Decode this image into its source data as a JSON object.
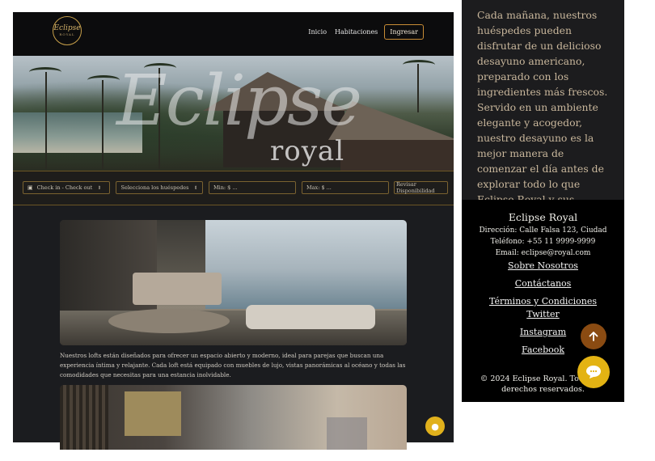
{
  "header": {
    "logo_text": "Eclipse",
    "logo_sub": "ROYAL",
    "nav": [
      "Inicio",
      "Habitaciones"
    ],
    "login_label": "Ingresar"
  },
  "hero": {
    "title": "Eclipse",
    "subtitle": "royal"
  },
  "search": {
    "dates_label": "Check in - Check out",
    "guests_label": "Selecciona los huéspedes",
    "min_placeholder": "Min: $ ...",
    "max_placeholder": "Max: $ ...",
    "submit_label": "Revisar Disponibilidad"
  },
  "room": {
    "description": "Nuestros lofts están diseñados para ofrecer un espacio abierto y moderno, ideal para parejas que buscan una experiencia íntima y relajante. Cada loft está equipado con muebles de lujo, vistas panorámicas al océano y todas las comodidades que necesitas para una estancia inolvidable."
  },
  "side_text": "Cada mañana, nuestros huéspedes pueden disfrutar de un delicioso desayuno americano, preparado con los ingredientes más frescos. Servido en un ambiente elegante y acogedor, nuestro desayuno es la mejor manera de comenzar el día antes de explorar todo lo que Eclipse Royal y sus alrededores tienen para ofrecer.",
  "footer": {
    "title": "Eclipse Royal",
    "address": "Dirección: Calle Falsa 123, Ciudad",
    "phone": "Teléfono: +55 11 9999-9999",
    "email": "Email: eclipse@royal.com",
    "links": [
      "Sobre Nosotros",
      "Contáctanos",
      "Términos y Condiciones",
      "Twitter",
      "Instagram",
      "Facebook"
    ],
    "copyright": "© 2024 Eclipse Royal. Todos los derechos reservados."
  },
  "icons": {
    "chat": "chat-bubble-icon",
    "up": "arrow-up-icon",
    "calendar": "calendar-icon",
    "chevron": "chevron-updown-icon"
  },
  "colors": {
    "accent_gold": "#e3b313",
    "accent_brown": "#8a4b12",
    "border_gold": "#7a6230"
  }
}
